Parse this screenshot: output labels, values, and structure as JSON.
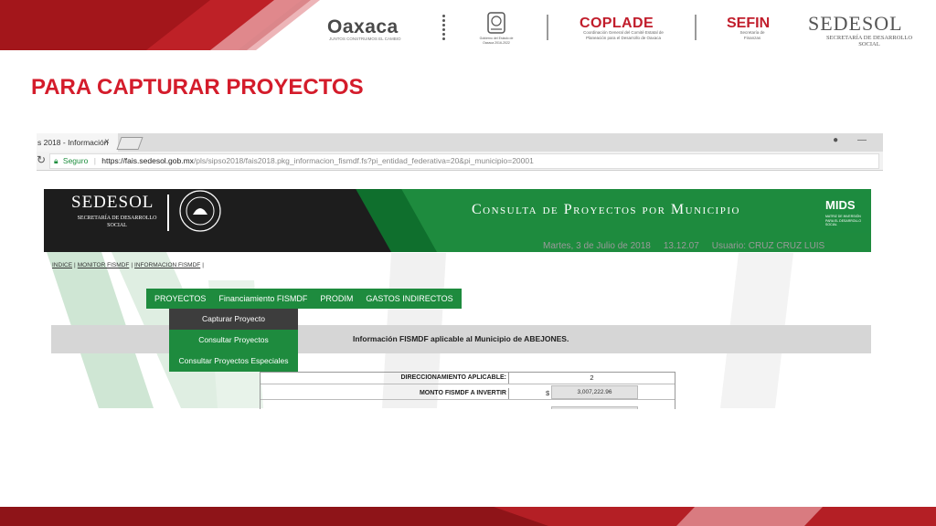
{
  "slide": {
    "title": "PARA CAPTURAR PROYECTOS",
    "colors": {
      "accent_red": "#d41c2b",
      "dark_red": "#8e1418",
      "green": "#1e8b3e"
    }
  },
  "header_logos": {
    "oaxaca": "Oaxaca",
    "oaxaca_sub": "JUNTOS CONSTRUIMOS EL CAMBIO",
    "seal_sub": "Gobierno del Estado de Oaxaca 2016-2022",
    "coplade": "COPLADE",
    "coplade_sub": "Coordinación General del Comité Estatal de Planeación para el Desarrollo de Oaxaca",
    "sefin": "SEFIN",
    "sefin_sub": "Secretaría de Finanzas",
    "sedesol": "SEDESOL",
    "sedesol_sub": "SECRETARÍA DE DESARROLLO SOCIAL"
  },
  "browser": {
    "tab_title": "s 2018 - Información",
    "tab_close": "×",
    "secure_label": "Seguro",
    "url_host": "https://fais.sedesol.gob.mx",
    "url_path": "/pls/sipso2018/fais2018.pkg_informacion_fismdf.fs?pi_entidad_federativa=20&pi_municipio=20001"
  },
  "page": {
    "banner_logo": "SEDESOL",
    "banner_logo_sub": "SECRETARÍA DE DESARROLLO SOCIAL",
    "banner_title": "Consulta de Proyectos por Municipio",
    "mids": "MIDS",
    "mids_sub": "MATRIZ DE INVERSIÓN PARA EL DESARROLLO SOCIAL",
    "date": "Martes, 3 de Julio de 2018",
    "time": "13.12.07",
    "user": "Usuario: CRUZ CRUZ LUIS",
    "links": [
      "INDICE",
      "MONITOR FISMDF",
      "INFORMACION FISMDF"
    ],
    "menu": [
      "PROYECTOS",
      "Financiamiento FISMDF",
      "PRODIM",
      "GASTOS INDIRECTOS"
    ],
    "dropdown": [
      "Capturar Proyecto",
      "Consultar Proyectos",
      "Consultar Proyectos Especiales"
    ],
    "info_text": "Información FISMDF aplicable al Municipio de ABEJONES.",
    "table": {
      "row1_label": "DIRECCIONAMIENTO APLICABLE:",
      "row1_value": "2",
      "row2_label": "MONTO FISMDF A INVERTIR",
      "currency": "$",
      "row2_value": "3,007,222.96"
    }
  }
}
